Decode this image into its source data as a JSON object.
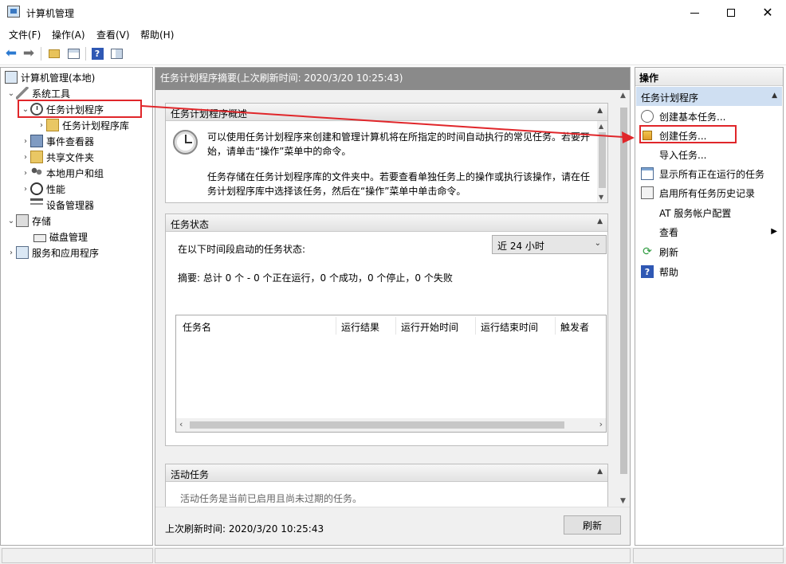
{
  "window": {
    "title": "计算机管理"
  },
  "menu": [
    "文件(F)",
    "操作(A)",
    "查看(V)",
    "帮助(H)"
  ],
  "tree": {
    "root": "计算机管理(本地)",
    "system_tools": "系统工具",
    "task_scheduler": "任务计划程序",
    "task_library": "任务计划程序库",
    "event_viewer": "事件查看器",
    "shared_folders": "共享文件夹",
    "local_users": "本地用户和组",
    "performance": "性能",
    "device_manager": "设备管理器",
    "storage": "存储",
    "disk_management": "磁盘管理",
    "services": "服务和应用程序"
  },
  "center": {
    "header": "任务计划程序摘要(上次刷新时间: 2020/3/20 10:25:43)",
    "overview": {
      "title": "任务计划程序概述",
      "p1": "可以使用任务计划程序来创建和管理计算机将在所指定的时间自动执行的常见任务。若要开始，请单击“操作”菜单中的命令。",
      "p2": "任务存储在任务计划程序库的文件夹中。若要查看单独任务上的操作或执行该操作，请在任务计划程序库中选择该任务，然后在“操作”菜单中单击命令。"
    },
    "status": {
      "title": "任务状态",
      "label": "在以下时间段启动的任务状态:",
      "range": "近 24 小时",
      "summary": "摘要: 总计 0 个 - 0 个正在运行，0 个成功，0 个停止，0 个失败",
      "columns": [
        "任务名",
        "运行结果",
        "运行开始时间",
        "运行结束时间",
        "触发者"
      ]
    },
    "active": {
      "title": "活动任务",
      "text": "活动任务是当前已启用且尚未过期的任务。"
    },
    "footer": {
      "last_refresh": "上次刷新时间: 2020/3/20 10:25:43",
      "refresh": "刷新"
    }
  },
  "actions": {
    "title": "操作",
    "section": "任务计划程序",
    "items": [
      "创建基本任务...",
      "创建任务...",
      "导入任务...",
      "显示所有正在运行的任务",
      "启用所有任务历史记录",
      "AT 服务帐户配置",
      "查看",
      "刷新",
      "帮助"
    ]
  },
  "colors": {
    "annotation_red": "#e0262a",
    "header_gray": "#8a8a8a",
    "selected_blue": "#cfdff2"
  }
}
